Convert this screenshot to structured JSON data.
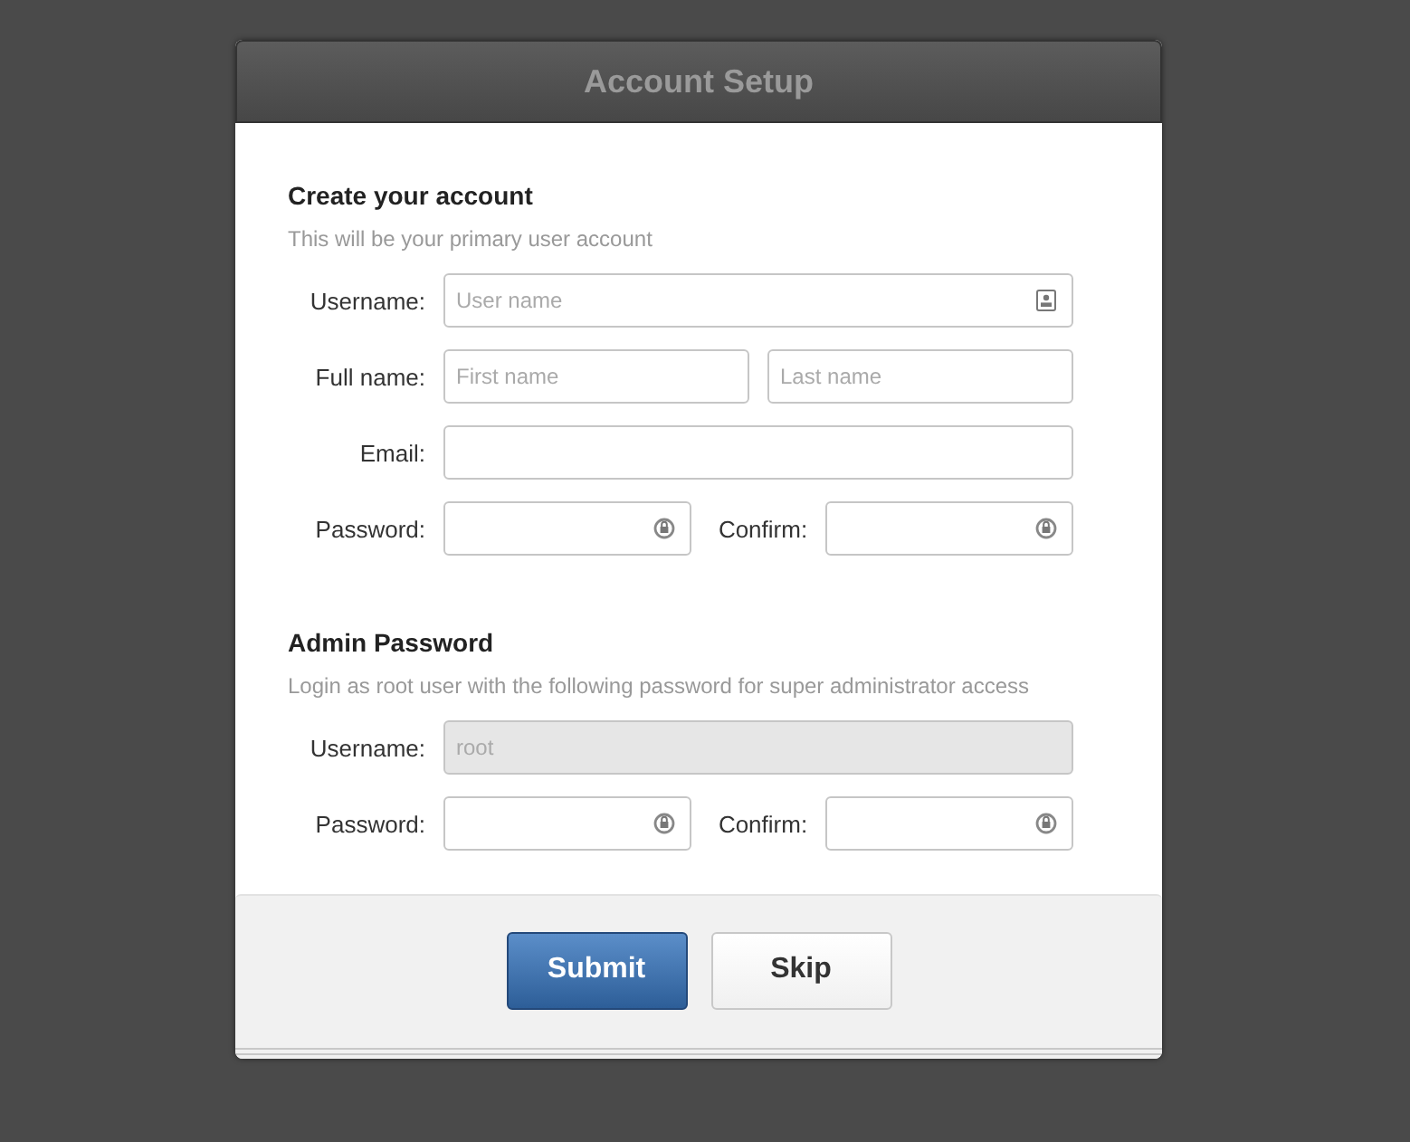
{
  "window": {
    "title": "Account Setup"
  },
  "sections": [
    {
      "title": "Create your account",
      "subtitle": "This will be your primary user account",
      "rows": [
        {
          "kind": "single",
          "label": "Username:",
          "fields": [
            {
              "placeholder": "User name",
              "kind": "contact",
              "disabled": false
            }
          ]
        },
        {
          "kind": "split",
          "label": "Full name:",
          "fields": [
            {
              "placeholder": "First name",
              "disabled": false
            },
            {
              "placeholder": "Last name",
              "disabled": false
            }
          ]
        },
        {
          "kind": "single",
          "label": "Email:",
          "fields": [
            {
              "disabled": false
            }
          ]
        },
        {
          "kind": "confirm",
          "label": "Password:",
          "second_label": "Confirm:",
          "fields": [
            {
              "kind": "password",
              "disabled": false
            },
            {
              "kind": "password",
              "disabled": false
            }
          ]
        }
      ]
    },
    {
      "title": "Admin Password",
      "subtitle": "Login as root user with the following password for super administrator access",
      "rows": [
        {
          "kind": "single",
          "label": "Username:",
          "fields": [
            {
              "value": "root",
              "disabled": true
            }
          ]
        },
        {
          "kind": "confirm",
          "label": "Password:",
          "second_label": "Confirm:",
          "fields": [
            {
              "kind": "password",
              "disabled": false
            },
            {
              "kind": "password",
              "disabled": false
            }
          ]
        }
      ]
    }
  ],
  "buttons": [
    {
      "label": "Submit",
      "primary": true
    },
    {
      "label": "Skip",
      "primary": false
    }
  ]
}
